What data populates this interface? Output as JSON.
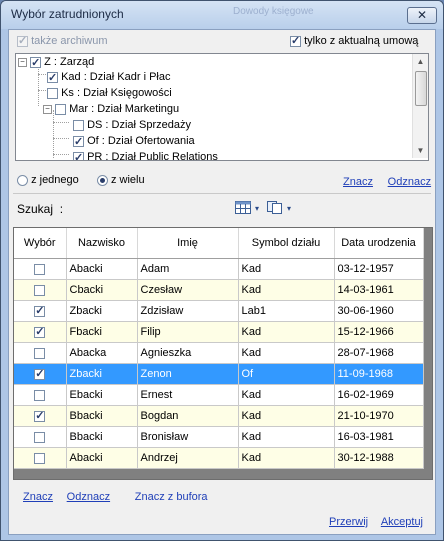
{
  "window": {
    "title": "Wybór zatrudnionych",
    "ghost_text": "Dowody księgowe",
    "close_glyph": "✕"
  },
  "options": {
    "archiwum_label": "także archiwum",
    "archiwum_checked": true,
    "aktualna_label": "tylko z aktualną umową",
    "aktualna_checked": true
  },
  "tree": [
    {
      "label": "Z : Zarząd",
      "checked": true,
      "expander": "−"
    },
    {
      "label": "Kad : Dział Kadr i Płac",
      "checked": true
    },
    {
      "label": "Ks : Dział Księgowości",
      "checked": false
    },
    {
      "label": "Mar : Dział Marketingu",
      "checked": false,
      "expander": "−"
    },
    {
      "label": "DS : Dział Sprzedaży",
      "checked": false
    },
    {
      "label": "Of : Dział Ofertowania",
      "checked": true
    },
    {
      "label": "PR : Dział Public Relations",
      "checked": true
    }
  ],
  "mode": {
    "single_label": "z jednego",
    "multi_label": "z wielu",
    "selected": "multi"
  },
  "tree_links": {
    "select": "Znacz",
    "deselect": "Odznacz"
  },
  "search": {
    "label": "Szukaj",
    "colon": ":",
    "value": "",
    "placeholder": ""
  },
  "table": {
    "columns": [
      "Wybór",
      "Nazwisko",
      "Imię",
      "Symbol działu",
      "Data urodzenia"
    ],
    "rows": [
      {
        "checked": false,
        "nazwisko": "Abacki",
        "imie": "Adam",
        "symbol": "Kad",
        "data": "03-12-1957"
      },
      {
        "checked": false,
        "nazwisko": "Cbacki",
        "imie": "Czesław",
        "symbol": "Kad",
        "data": "14-03-1961"
      },
      {
        "checked": true,
        "nazwisko": "Zbacki",
        "imie": "Zdzisław",
        "symbol": "Lab1",
        "data": "30-06-1960"
      },
      {
        "checked": true,
        "nazwisko": "Fbacki",
        "imie": "Filip",
        "symbol": "Kad",
        "data": "15-12-1966"
      },
      {
        "checked": false,
        "nazwisko": "Abacka",
        "imie": "Agnieszka",
        "symbol": "Kad",
        "data": "28-07-1968"
      },
      {
        "checked": true,
        "nazwisko": "Zbacki",
        "imie": "Zenon",
        "symbol": "Of",
        "data": "11-09-1968",
        "selected": true
      },
      {
        "checked": false,
        "nazwisko": "Ebacki",
        "imie": "Ernest",
        "symbol": "Kad",
        "data": "16-02-1969"
      },
      {
        "checked": true,
        "nazwisko": "Bbacki",
        "imie": "Bogdan",
        "symbol": "Kad",
        "data": "21-10-1970"
      },
      {
        "checked": false,
        "nazwisko": "Bbacki",
        "imie": "Bronisław",
        "symbol": "Kad",
        "data": "16-03-1981"
      },
      {
        "checked": false,
        "nazwisko": "Abacki",
        "imie": "Andrzej",
        "symbol": "Kad",
        "data": "30-12-1988"
      }
    ]
  },
  "bottom": {
    "select": "Znacz",
    "deselect": "Odznacz",
    "from_buffer": "Znacz z bufora",
    "cancel": "Przerwij",
    "accept": "Akceptuj"
  },
  "icons": {
    "grid_icon": "grid-icon",
    "copy_icon": "copy-icon"
  },
  "colors": {
    "selection": "#3399ff",
    "link": "#1f3fb8",
    "alt_row": "#fefee6"
  }
}
